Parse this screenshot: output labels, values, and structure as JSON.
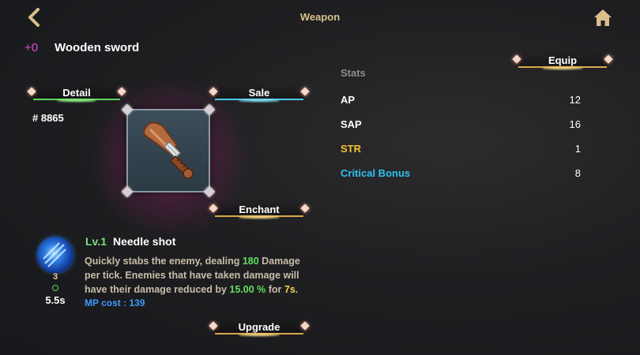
{
  "header": {
    "title": "Weapon",
    "back_icon": "chevron-left-icon",
    "home_icon": "home-icon"
  },
  "item": {
    "plus_level": "+0",
    "name": "Wooden sword",
    "id": "# 8865",
    "icon": "wooden-sword-icon",
    "rarity_color": "#d63c8c"
  },
  "buttons": {
    "equip": "Equip",
    "detail": "Detail",
    "sale": "Sale",
    "enchant": "Enchant",
    "upgrade": "Upgrade"
  },
  "stats": {
    "title": "Stats",
    "rows": [
      {
        "name": "AP",
        "value": "12",
        "color": "#ffffff"
      },
      {
        "name": "SAP",
        "value": "16",
        "color": "#ffffff"
      },
      {
        "name": "STR",
        "value": "1",
        "color": "#f2c230"
      },
      {
        "name": "Critical Bonus",
        "value": "8",
        "color": "#2fc0f0"
      }
    ]
  },
  "skill": {
    "level": "Lv.1",
    "name": "Needle shot",
    "desc_parts": {
      "p1": "Quickly stabs the enemy, dealing ",
      "dmg": "180",
      "p2": " Damage per tick. Enemies that have taken damage will have their damage reduced by ",
      "pct": "15.00 %",
      "p3": " for ",
      "dur": "7s",
      "p4": "."
    },
    "mp_cost": "MP cost : 139",
    "count": "3",
    "cooldown": "5.5s",
    "icon": "needle-shot-skill-icon"
  }
}
